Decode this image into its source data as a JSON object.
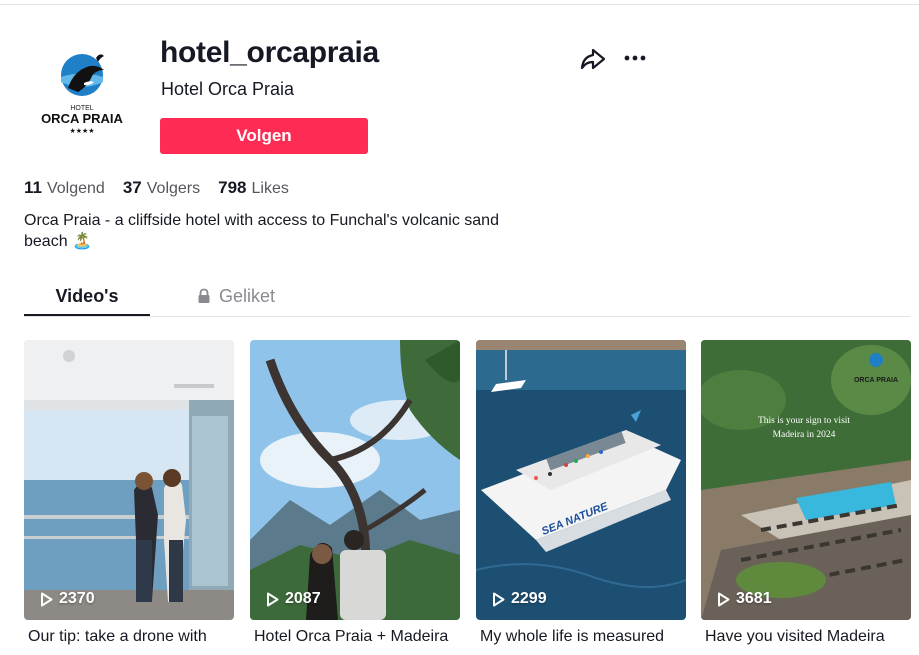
{
  "profile": {
    "handle": "hotel_orcapraia",
    "nickname": "Hotel Orca Praia",
    "follow_label": "Volgen",
    "logo_text": {
      "small": "HOTEL",
      "main": "ORCA PRAIA",
      "stars": "★★★★"
    },
    "bio_line1": "Orca Praia - a cliffside hotel with access to Funchal's volcanic sand",
    "bio_line2": "beach 🏝️"
  },
  "stats": [
    {
      "number": "11",
      "label": "Volgend"
    },
    {
      "number": "37",
      "label": "Volgers"
    },
    {
      "number": "798",
      "label": "Likes"
    }
  ],
  "tabs": [
    {
      "label": "Video's",
      "active": true
    },
    {
      "label": "Geliket",
      "active": false,
      "icon": "lock-icon"
    }
  ],
  "videos": [
    {
      "views": "2370",
      "caption": "Our tip: take a drone with"
    },
    {
      "views": "2087",
      "caption": "Hotel Orca Praia + Madeira"
    },
    {
      "views": "2299",
      "caption": "My whole life is measured",
      "boat_text": "SEA NATURE"
    },
    {
      "views": "3681",
      "caption": "Have you visited Madeira",
      "overlay_line1": "This is your sign to visit",
      "overlay_line2": "Madeira in 2024",
      "logo": "ORCA PRAIA"
    }
  ],
  "colors": {
    "accent": "#fe2c55",
    "text": "#161823",
    "muted": "#8a8b91"
  }
}
